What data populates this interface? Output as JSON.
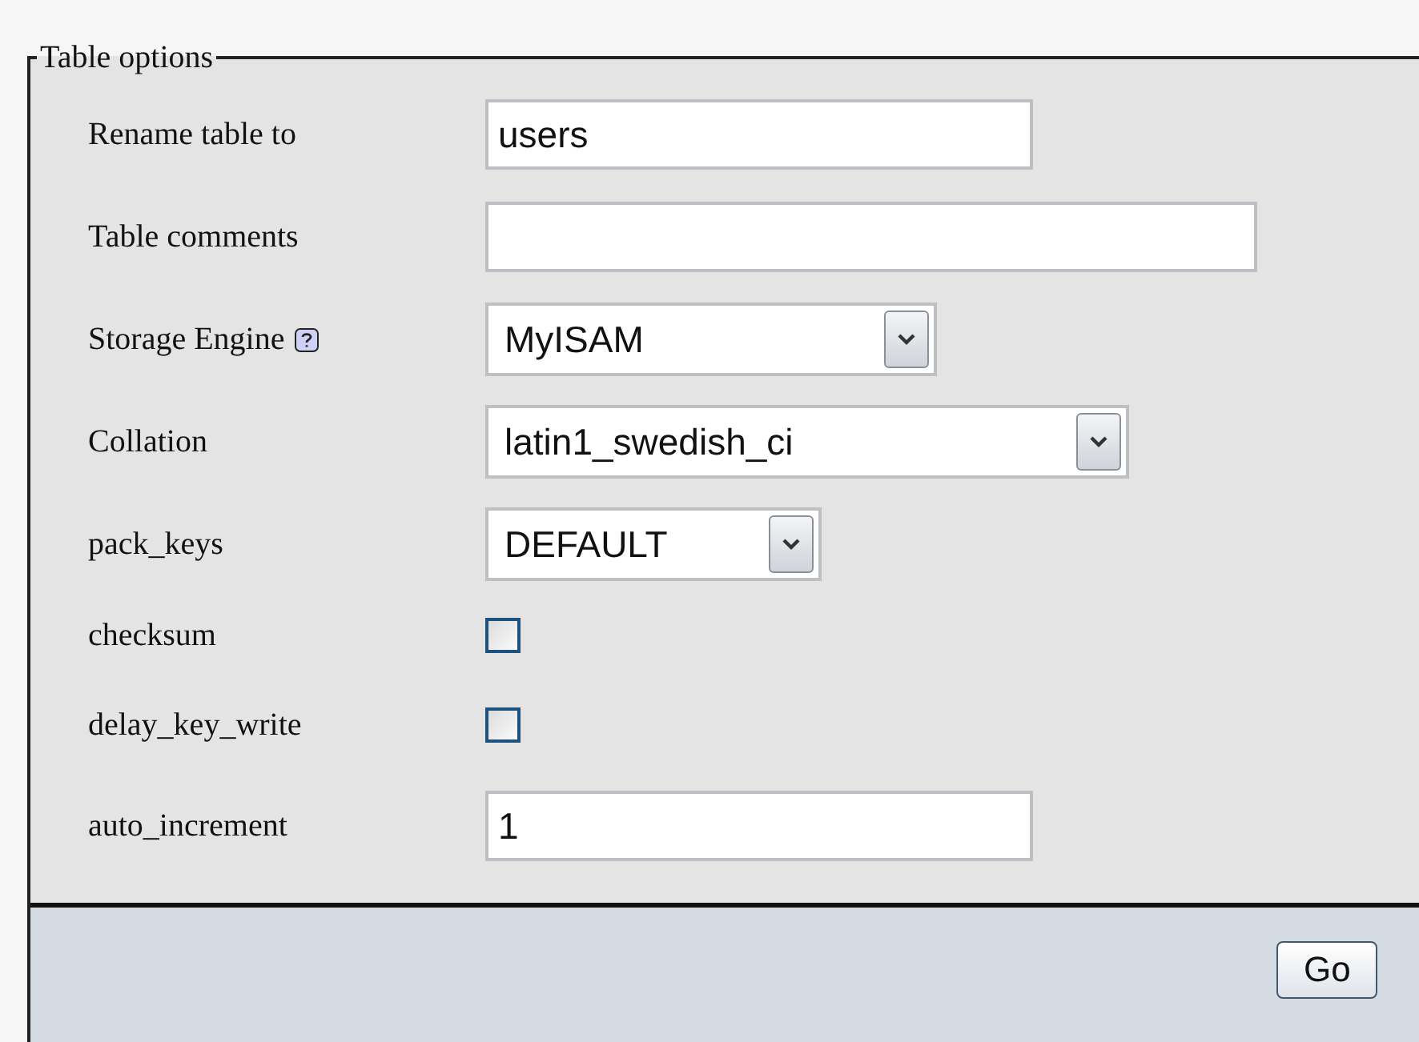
{
  "legend": "Table options",
  "rows": [
    {
      "kind": "text",
      "label": "Rename table to",
      "value": "users"
    },
    {
      "kind": "text",
      "label": "Table comments",
      "value": ""
    },
    {
      "kind": "select",
      "label": "Storage Engine",
      "help": true,
      "value": "MyISAM"
    },
    {
      "kind": "select",
      "label": "Collation",
      "value": "latin1_swedish_ci"
    },
    {
      "kind": "select",
      "label": "pack_keys",
      "value": "DEFAULT"
    },
    {
      "kind": "checkbox",
      "label": "checksum",
      "checked": false
    },
    {
      "kind": "checkbox",
      "label": "delay_key_write",
      "checked": false
    },
    {
      "kind": "text",
      "label": "auto_increment",
      "value": "1"
    }
  ],
  "button": "Go"
}
